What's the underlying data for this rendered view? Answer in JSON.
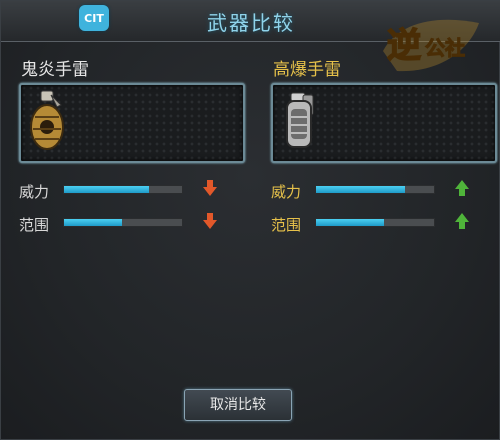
{
  "header": {
    "title": "武器比较",
    "app_icon_text": "CIT",
    "logo_text": "逆公社"
  },
  "left": {
    "name": "鬼炎手雷",
    "stats": [
      {
        "label": "威力",
        "value": 0.72,
        "trend": "down"
      },
      {
        "label": "范围",
        "value": 0.49,
        "trend": "down"
      }
    ]
  },
  "right": {
    "name": "高爆手雷",
    "stats": [
      {
        "label": "威力",
        "value": 0.75,
        "trend": "up"
      },
      {
        "label": "范围",
        "value": 0.58,
        "trend": "up"
      }
    ]
  },
  "footer": {
    "cancel_label": "取消比较"
  },
  "colors": {
    "title": "#8fd3ea",
    "gold": "#e6c14a",
    "bar": "#29b3e2",
    "down": "#e2582a",
    "up": "#4fb43a"
  }
}
